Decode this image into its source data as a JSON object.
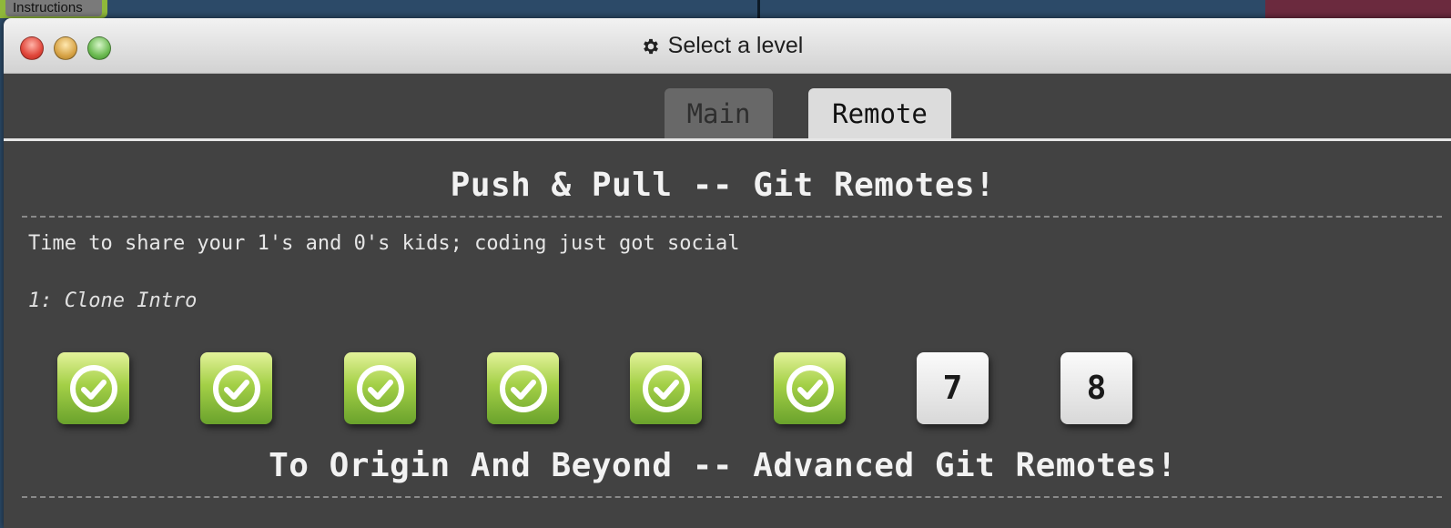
{
  "background": {
    "instructions_label": "Instructions"
  },
  "window": {
    "title": "Select a level",
    "title_icon": "gear-icon"
  },
  "tabs": [
    {
      "label": "Main",
      "selected": false
    },
    {
      "label": "Remote",
      "selected": true
    }
  ],
  "sections": [
    {
      "title": "Push & Pull -- Git Remotes!",
      "about": "Time to share your 1's and 0's kids; coding just got social",
      "current_level": "1: Clone Intro",
      "levels": [
        {
          "label": "1",
          "completed": true,
          "icon": "check-circle-icon"
        },
        {
          "label": "2",
          "completed": true,
          "icon": "check-circle-icon"
        },
        {
          "label": "3",
          "completed": true,
          "icon": "check-circle-icon"
        },
        {
          "label": "4",
          "completed": true,
          "icon": "check-circle-icon"
        },
        {
          "label": "5",
          "completed": true,
          "icon": "check-circle-icon"
        },
        {
          "label": "6",
          "completed": true,
          "icon": "check-circle-icon"
        },
        {
          "label": "7",
          "completed": false
        },
        {
          "label": "8",
          "completed": false
        }
      ]
    },
    {
      "title": "To Origin And Beyond -- Advanced Git Remotes!"
    }
  ],
  "colors": {
    "completed_level": "#8dc23e",
    "window_background": "#424242"
  }
}
